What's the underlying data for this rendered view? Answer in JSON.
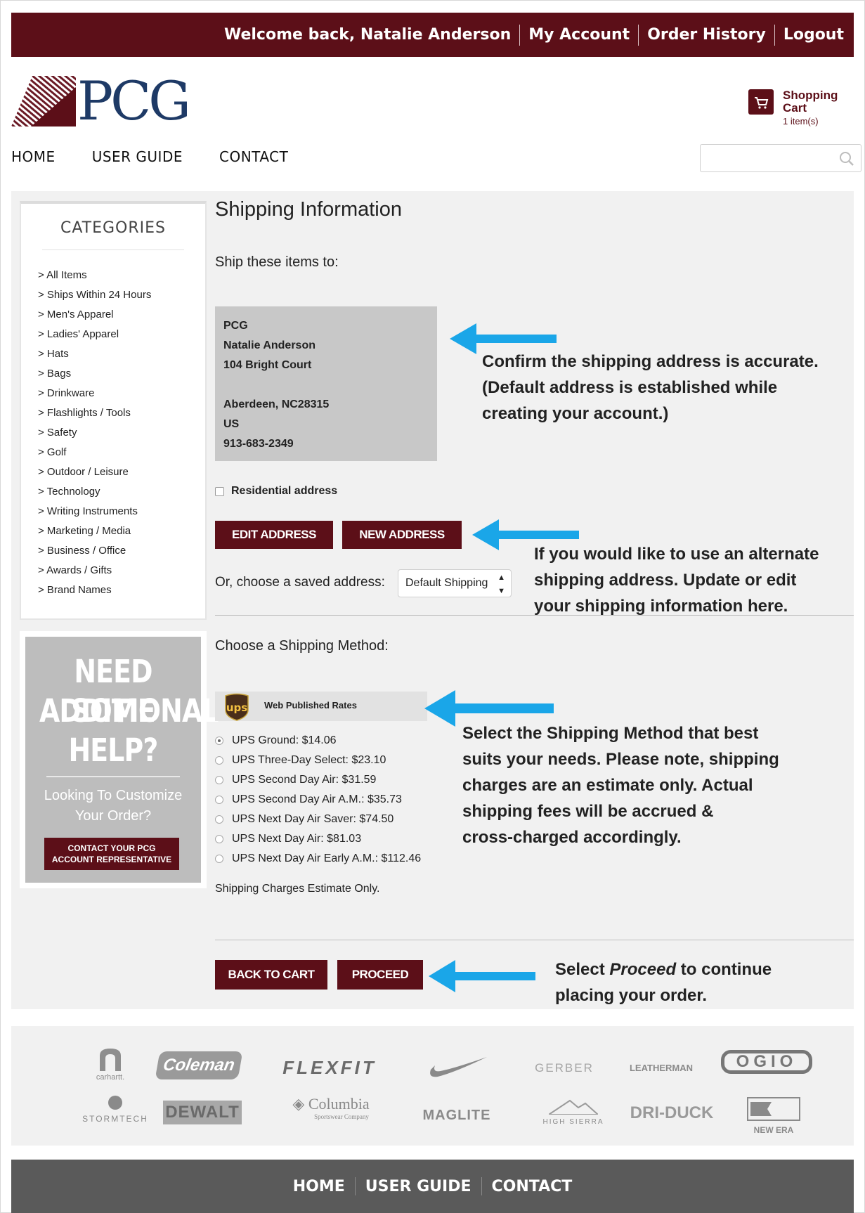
{
  "header": {
    "welcome": "Welcome back, Natalie Anderson",
    "links": [
      "My Account",
      "Order History",
      "Logout"
    ]
  },
  "logo": {
    "text": "PCG"
  },
  "cart": {
    "title": "Shopping Cart",
    "count": "1 item(s)"
  },
  "nav": {
    "items": [
      "HOME",
      "USER GUIDE",
      "CONTACT"
    ]
  },
  "search": {
    "placeholder": ""
  },
  "sidebar": {
    "title": "CATEGORIES",
    "items": [
      "> All Items",
      "> Ships Within 24 Hours",
      "> Men's Apparel",
      "> Ladies' Apparel",
      "> Hats",
      "> Bags",
      "> Drinkware",
      "> Flashlights / Tools",
      "> Safety",
      "> Golf",
      "> Outdoor / Leisure",
      "> Technology",
      "> Writing Instruments",
      "> Marketing / Media",
      "> Business / Office",
      "> Awards / Gifts",
      "> Brand Names"
    ]
  },
  "help_banner": {
    "line1": "NEED SOME",
    "line2": "ADDITIONAL",
    "line3": "HELP?",
    "sub1": "Looking To Customize",
    "sub2": "Your Order?",
    "button1": "CONTACT YOUR PCG",
    "button2": "ACCOUNT REPRESENTATIVE"
  },
  "shipping": {
    "title": "Shipping Information",
    "ship_to_label": "Ship these items to:",
    "address": [
      "PCG",
      "Natalie Anderson",
      "104 Bright Court",
      "",
      "Aberdeen, NC28315",
      "US",
      "913-683-2349"
    ],
    "residential_label": "Residential address",
    "residential_checked": false,
    "edit_button": "EDIT ADDRESS",
    "new_button": "NEW ADDRESS",
    "saved_label": "Or, choose a saved address:",
    "saved_value": "Default Shipping"
  },
  "method": {
    "title": "Choose a Shipping Method:",
    "carrier_logo": "ups",
    "carrier_label": "Web Published Rates",
    "selected_index": 0,
    "options": [
      "UPS Ground: $14.06",
      "UPS Three-Day Select: $23.10",
      "UPS Second Day Air: $31.59",
      "UPS Second Day Air A.M.: $35.73",
      "UPS Next Day Air Saver: $74.50",
      "UPS Next Day Air: $81.03",
      "UPS Next Day Air Early A.M.: $112.46"
    ],
    "estimate_note": "Shipping Charges Estimate Only."
  },
  "actions": {
    "back": "BACK TO CART",
    "proceed": "PROCEED"
  },
  "annotations": {
    "address": [
      "Confirm the shipping address is accurate.",
      "(Default address is established while",
      "creating your account.)"
    ],
    "alternate": [
      "If you would like to use an alternate",
      "shipping address. Update or edit",
      "your shipping information here."
    ],
    "method": [
      "Select the Shipping Method that best",
      "suits your needs. Please note, shipping",
      "charges are an estimate only. Actual",
      "shipping fees will be accrued &",
      "cross-charged accordingly."
    ],
    "proceed_pre": "Select ",
    "proceed_em": "Proceed",
    "proceed_post": " to continue",
    "proceed_line2": "placing your order."
  },
  "brands": [
    "carhartt.",
    "Coleman",
    "FLEXFIT",
    "nike-swoosh",
    "GERBER",
    "LEATHERMAN",
    "OGIO",
    "STORMTECH",
    "DEWALT",
    "Columbia",
    "Sportswear Company",
    "MAGLITE",
    "HIGH SIERRA",
    "DRI-DUCK",
    "NEW ERA"
  ],
  "footer": {
    "links": [
      "HOME",
      "USER GUIDE",
      "CONTACT"
    ]
  },
  "colors": {
    "brand": "#5c0f18",
    "arrow": "#1aa6e8",
    "footer": "#5a5a5a",
    "panel": "#f1f1f1"
  }
}
